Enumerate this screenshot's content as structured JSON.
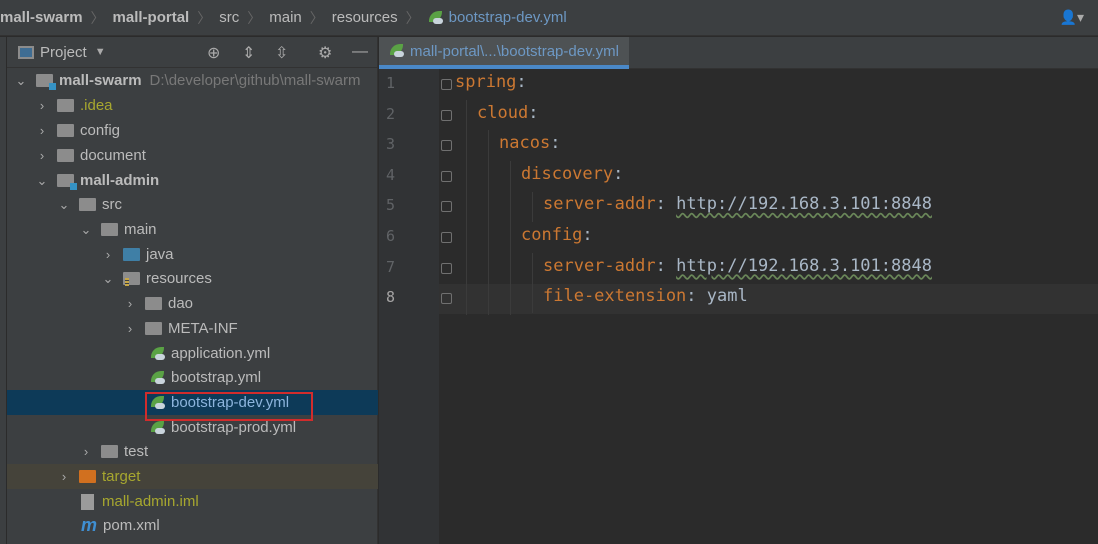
{
  "breadcrumb": [
    "mall-swarm",
    "mall-portal",
    "src",
    "main",
    "resources",
    "bootstrap-dev.yml"
  ],
  "sidebar": {
    "title": "Project",
    "tree": [
      {
        "label": "mall-swarm",
        "path": "D:\\developer\\github\\mall-swarm"
      },
      {
        "label": ".idea"
      },
      {
        "label": "config"
      },
      {
        "label": "document"
      },
      {
        "label": "mall-admin"
      },
      {
        "label": "src"
      },
      {
        "label": "main"
      },
      {
        "label": "java"
      },
      {
        "label": "resources"
      },
      {
        "label": "dao"
      },
      {
        "label": "META-INF"
      },
      {
        "label": "application.yml"
      },
      {
        "label": "bootstrap.yml"
      },
      {
        "label": "bootstrap-dev.yml"
      },
      {
        "label": "bootstrap-prod.yml"
      },
      {
        "label": "test"
      },
      {
        "label": "target"
      },
      {
        "label": "mall-admin.iml"
      },
      {
        "label": "pom.xml"
      }
    ]
  },
  "editor": {
    "tab": "mall-portal\\...\\bootstrap-dev.yml",
    "lines": [
      {
        "n": "1",
        "key": "spring",
        "sep": ":",
        "val": ""
      },
      {
        "n": "2",
        "key": "cloud",
        "sep": ":",
        "val": ""
      },
      {
        "n": "3",
        "key": "nacos",
        "sep": ":",
        "val": ""
      },
      {
        "n": "4",
        "key": "discovery",
        "sep": ":",
        "val": ""
      },
      {
        "n": "5",
        "key": "server-addr",
        "sep": ": ",
        "val": "http://192.168.3.101:8848"
      },
      {
        "n": "6",
        "key": "config",
        "sep": ":",
        "val": ""
      },
      {
        "n": "7",
        "key": "server-addr",
        "sep": ": ",
        "val": "http://192.168.3.101:8848"
      },
      {
        "n": "8",
        "key": "file-extension",
        "sep": ": ",
        "val": "yaml"
      }
    ]
  }
}
